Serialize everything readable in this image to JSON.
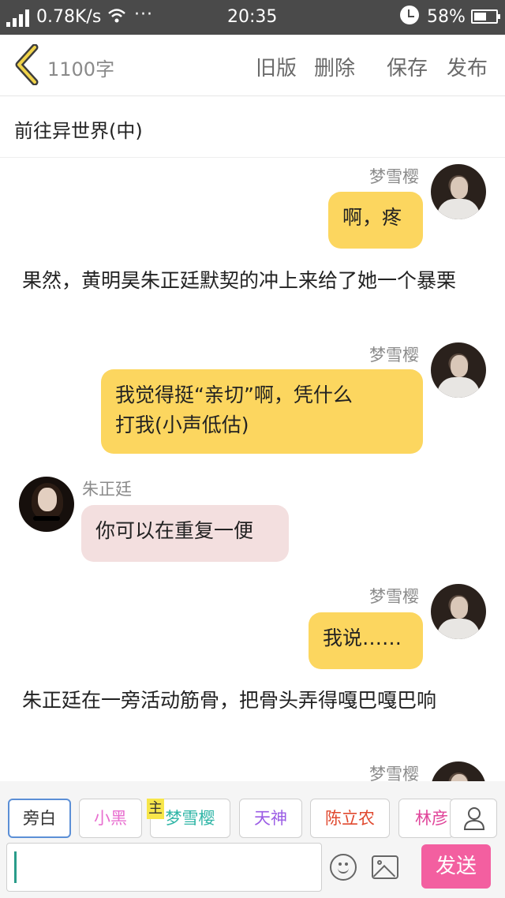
{
  "status_bar": {
    "network_speed": "0.78K/s",
    "more": "···",
    "time": "20:35",
    "battery_percent": "58%",
    "battery_level": 0.58
  },
  "toolbar": {
    "word_count": "1100字",
    "old_version": "旧版",
    "delete": "删除",
    "save": "保存",
    "publish": "发布"
  },
  "chapter_title": "前往异世界(中)",
  "messages": [
    {
      "speaker": "梦雪樱",
      "side": "right",
      "text": "啊，疼"
    },
    {
      "narration": "果然，黄明昊朱正廷默契的冲上来给了她一个暴栗"
    },
    {
      "speaker": "梦雪樱",
      "side": "right",
      "lines": [
        "我觉得挺“亲切”啊，凭什么",
        "打我(小声低估)"
      ]
    },
    {
      "speaker": "朱正廷",
      "side": "left",
      "text": "你可以在重复一便"
    },
    {
      "speaker": "梦雪樱",
      "side": "right",
      "text": "我说……"
    },
    {
      "narration": "朱正廷在一旁活动筋骨，把骨头弄得嘎巴嘎巴响"
    },
    {
      "speaker": "梦雪樱",
      "side": "right",
      "partial": true
    }
  ],
  "characters": [
    {
      "name": "旁白",
      "color": "#333333",
      "active": true
    },
    {
      "name": "小黑",
      "color": "#e86fd0"
    },
    {
      "name": "梦雪樱",
      "color": "#2fb5a6",
      "tag": "主"
    },
    {
      "name": "天神",
      "color": "#9b5de5"
    },
    {
      "name": "陈立农",
      "color": "#e0492f"
    },
    {
      "name": "林彦",
      "color": "#e0449a"
    }
  ],
  "input": {
    "value": "",
    "send_label": "发送"
  },
  "colors": {
    "my_bubble": "#fcd65f",
    "other_bubble": "#f3dfdf",
    "send_button": "#f35fa0",
    "status_bar": "#4a4a4a"
  }
}
